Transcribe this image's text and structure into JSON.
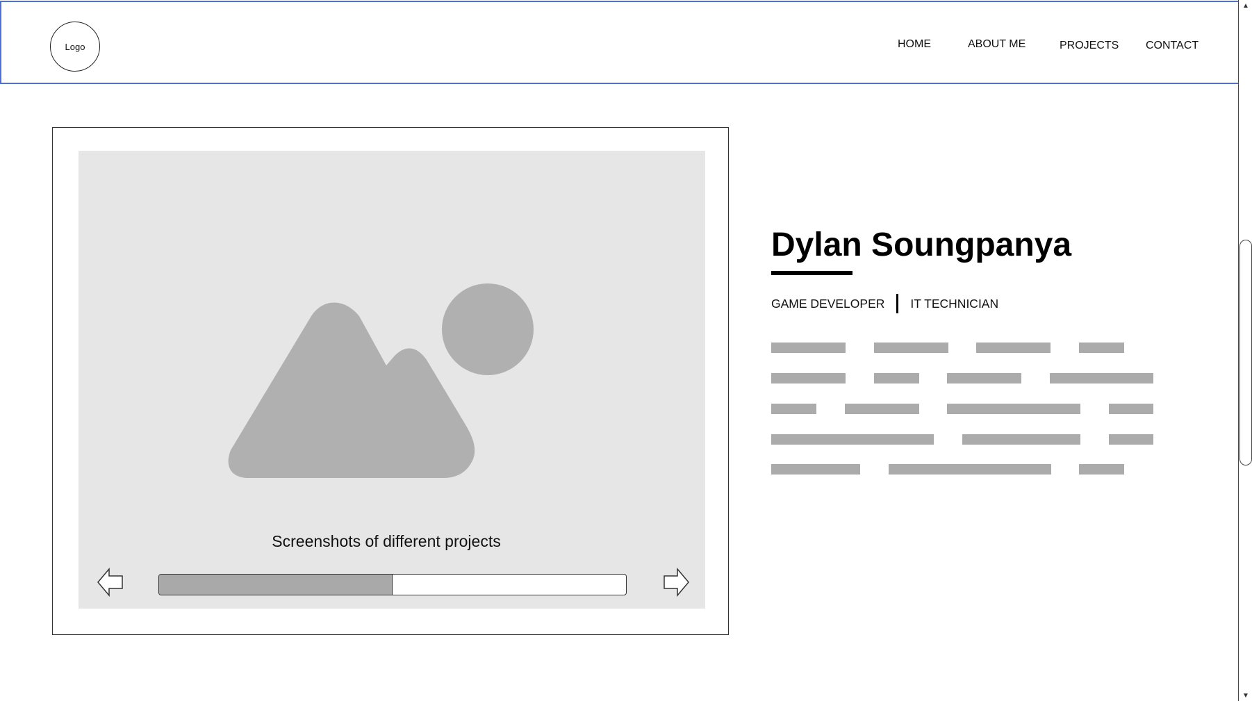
{
  "header": {
    "logo_label": "Logo",
    "nav": [
      {
        "label": "HOME"
      },
      {
        "label": "ABOUT ME"
      },
      {
        "label": "PROJECTS"
      },
      {
        "label": "CONTACT"
      }
    ]
  },
  "slider": {
    "caption": "Screenshots of different projects",
    "progress_fraction": 0.5,
    "prev_icon": "arrow-left-icon",
    "next_icon": "arrow-right-icon",
    "image_icon": "image-placeholder-icon"
  },
  "profile": {
    "name": "Dylan Soungpanya",
    "roles": [
      "GAME DEVELOPER",
      "IT TECHNICIAN"
    ]
  },
  "colors": {
    "header_border": "#4f6fd8",
    "placeholder_bg": "#e6e6e6",
    "placeholder_shape": "#b0b0b0",
    "text_line": "#ababab",
    "progress_fill": "#a9a9a9"
  }
}
